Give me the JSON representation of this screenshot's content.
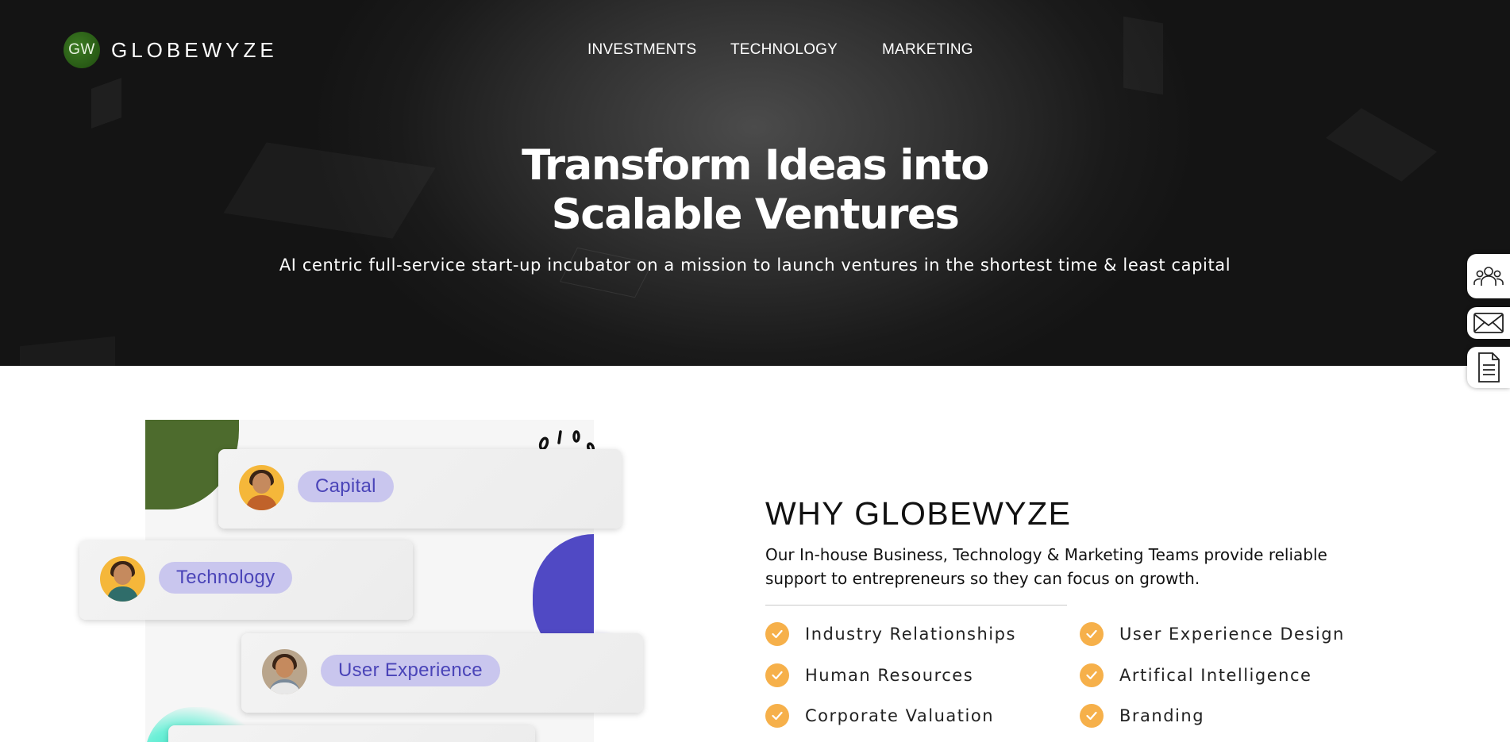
{
  "brand": {
    "badge": "GW",
    "name": "GLOBEWYZE"
  },
  "nav": {
    "items": [
      "INVESTMENTS",
      "TECHNOLOGY",
      "MARKETING"
    ]
  },
  "hero": {
    "title_line1": "Transform Ideas into",
    "title_line2": "Scalable Ventures",
    "subtitle": "AI centric full-service start-up incubator on a mission to launch ventures in the shortest time & least capital"
  },
  "side_actions": [
    "team-icon",
    "mail-icon",
    "document-icon"
  ],
  "illustration": {
    "cards": [
      "Capital",
      "Technology",
      "User Experience"
    ]
  },
  "why": {
    "title": "WHY GLOBEWYZE",
    "description": "Our In-house Business, Technology & Marketing Teams provide reliable support to entrepreneurs so they can focus on growth.",
    "features": [
      "Industry Relationships",
      "User Experience Design",
      "Human Resources",
      "Artifical Intelligence",
      "Corporate Valuation",
      "Branding"
    ]
  },
  "colors": {
    "hero_bg": "#1a1a1a",
    "brand_green": "#285a15",
    "check_orange": "#f6b04a",
    "pill_bg": "#c9c6ee",
    "pill_text": "#4a44b8",
    "accent_purple": "#5049c4"
  }
}
